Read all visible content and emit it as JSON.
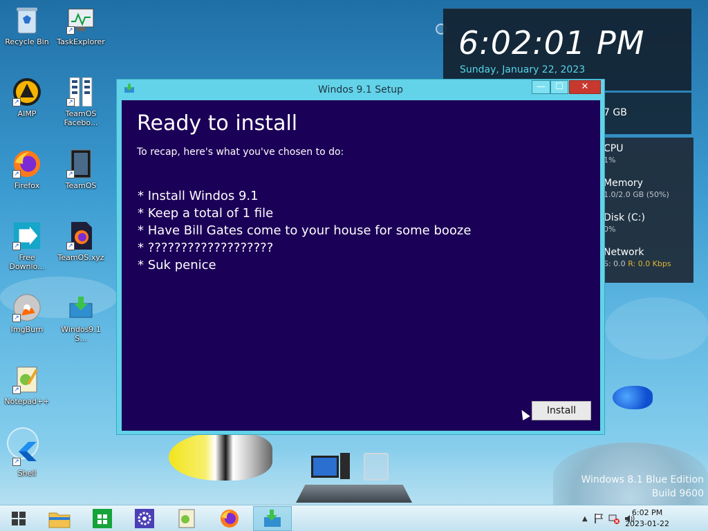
{
  "desktop": {
    "icons": [
      {
        "label": "Recycle Bin",
        "icon": "recycle-bin-icon"
      },
      {
        "label": "TaskExplorer",
        "icon": "task-explorer-icon"
      },
      {
        "label": "AIMP",
        "icon": "aimp-icon"
      },
      {
        "label": "TeamOS Facebo...",
        "icon": "teamos-facebook-icon"
      },
      {
        "label": "Firefox",
        "icon": "firefox-icon"
      },
      {
        "label": "TeamOS",
        "icon": "teamos-icon"
      },
      {
        "label": "Free Downlo...",
        "icon": "free-download-icon"
      },
      {
        "label": "TeamOS.xyz",
        "icon": "teamos-xyz-icon"
      },
      {
        "label": "ImgBurn",
        "icon": "imgburn-icon"
      },
      {
        "label": "Windos9.1 S...",
        "icon": "setup-icon"
      },
      {
        "label": "Notepad++",
        "icon": "notepadpp-icon"
      },
      {
        "label": "Shell",
        "icon": "shell-icon"
      }
    ]
  },
  "widgets": {
    "clock": {
      "time": "6:02:01 PM",
      "date": "Sunday, January 22, 2023"
    },
    "ram_value": "7 GB",
    "perf": {
      "cpu_label": "CPU",
      "cpu_value": "1%",
      "memory_label": "Memory",
      "memory_value": "1.0/2.0 GB (50%)",
      "disk_label": "Disk (C:)",
      "disk_value": "0%",
      "network_label": "Network",
      "network_s": "S: 0.0",
      "network_r": "R: 0.0 Kbps"
    }
  },
  "setup_window": {
    "title": "Windos 9.1 Setup",
    "heading": "Ready to install",
    "recap": "To recap, here's what you've chosen to do:",
    "items": [
      "* Install Windos 9.1",
      "* Keep a total of 1 file",
      "* Have Bill Gates come to your house for some booze",
      "* ???????????????????",
      "* Suk penice"
    ],
    "install_label": "Install",
    "min_glyph": "—",
    "max_glyph": "☐",
    "close_glyph": "✕"
  },
  "watermark": {
    "line1": "Windows 8.1 Blue Edition",
    "line2": "Build 9600"
  },
  "taskbar": {
    "buttons": [
      "start-icon",
      "file-explorer-icon",
      "store-icon",
      "settings-icon",
      "notepadpp-icon",
      "firefox-icon",
      "setup-icon"
    ],
    "tray_time": "6:02 PM",
    "tray_date": "2023-01-22"
  }
}
